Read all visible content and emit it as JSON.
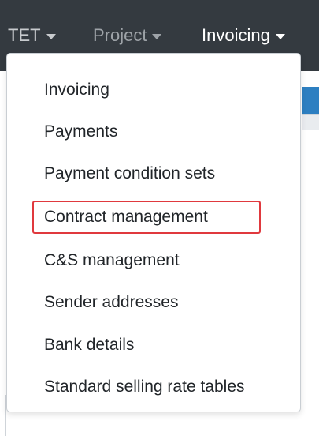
{
  "navbar": {
    "items": [
      {
        "label": "TET"
      },
      {
        "label": "Project"
      },
      {
        "label": "Invoicing"
      }
    ]
  },
  "dropdown": {
    "items": [
      {
        "label": "Invoicing"
      },
      {
        "label": "Payments"
      },
      {
        "label": "Payment condition sets"
      },
      {
        "label": "Contract management"
      },
      {
        "label": "C&S management"
      },
      {
        "label": "Sender addresses"
      },
      {
        "label": "Bank details"
      },
      {
        "label": "Standard selling rate tables"
      }
    ],
    "highlighted_item": "Contract management"
  },
  "colors": {
    "navbar_bg": "#343a40",
    "active_nav_text": "#ffffff",
    "highlight_border": "#e0393e",
    "accent_blue": "#2d7fc1"
  }
}
